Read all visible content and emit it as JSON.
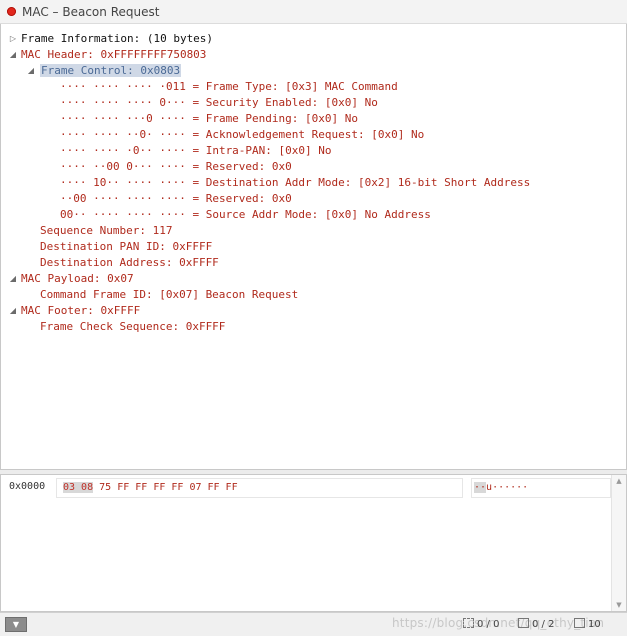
{
  "window": {
    "title": "MAC – Beacon Request"
  },
  "tree": {
    "frame_info": "Frame Information: (10 bytes)",
    "mac_header": "MAC Header: 0xFFFFFFFF750803",
    "frame_control": "Frame Control: 0x0803",
    "fc_fields": [
      "···· ···· ···· ·011 = Frame Type: [0x3] MAC Command",
      "···· ···· ···· 0··· = Security Enabled: [0x0] No",
      "···· ···· ···0 ···· = Frame Pending: [0x0] No",
      "···· ···· ··0· ···· = Acknowledgement Request: [0x0] No",
      "···· ···· ·0·· ···· = Intra-PAN: [0x0] No",
      "···· ··00 0··· ···· = Reserved: 0x0",
      "···· 10·· ···· ···· = Destination Addr Mode: [0x2] 16-bit Short Address",
      "··00 ···· ···· ···· = Reserved: 0x0",
      "00·· ···· ···· ···· = Source Addr Mode: [0x0] No Address"
    ],
    "sequence_number": "Sequence Number: 117",
    "dest_pan_id": "Destination PAN ID: 0xFFFF",
    "dest_address": "Destination Address: 0xFFFF",
    "mac_payload": "MAC Payload: 0x07",
    "command_frame_id": "Command Frame ID: [0x07] Beacon Request",
    "mac_footer": "MAC Footer: 0xFFFF",
    "fcs": "Frame Check Sequence: 0xFFFF"
  },
  "hex": {
    "offset": "0x0000",
    "highlighted_bytes": "03 08",
    "remaining_bytes": " 75 FF FF FF FF 07 FF FF",
    "ascii_highlight": "··",
    "ascii_rest": "u······"
  },
  "status": {
    "frames": "0 / 0",
    "pages": "0 / 2",
    "size": "10",
    "watermark": "https://blog.csdn.net/qq_ethy_tian"
  },
  "colors": {
    "field_text": "#b02a1c",
    "selection_bg": "#cfd8e6",
    "title_dot": "#e2261c"
  }
}
